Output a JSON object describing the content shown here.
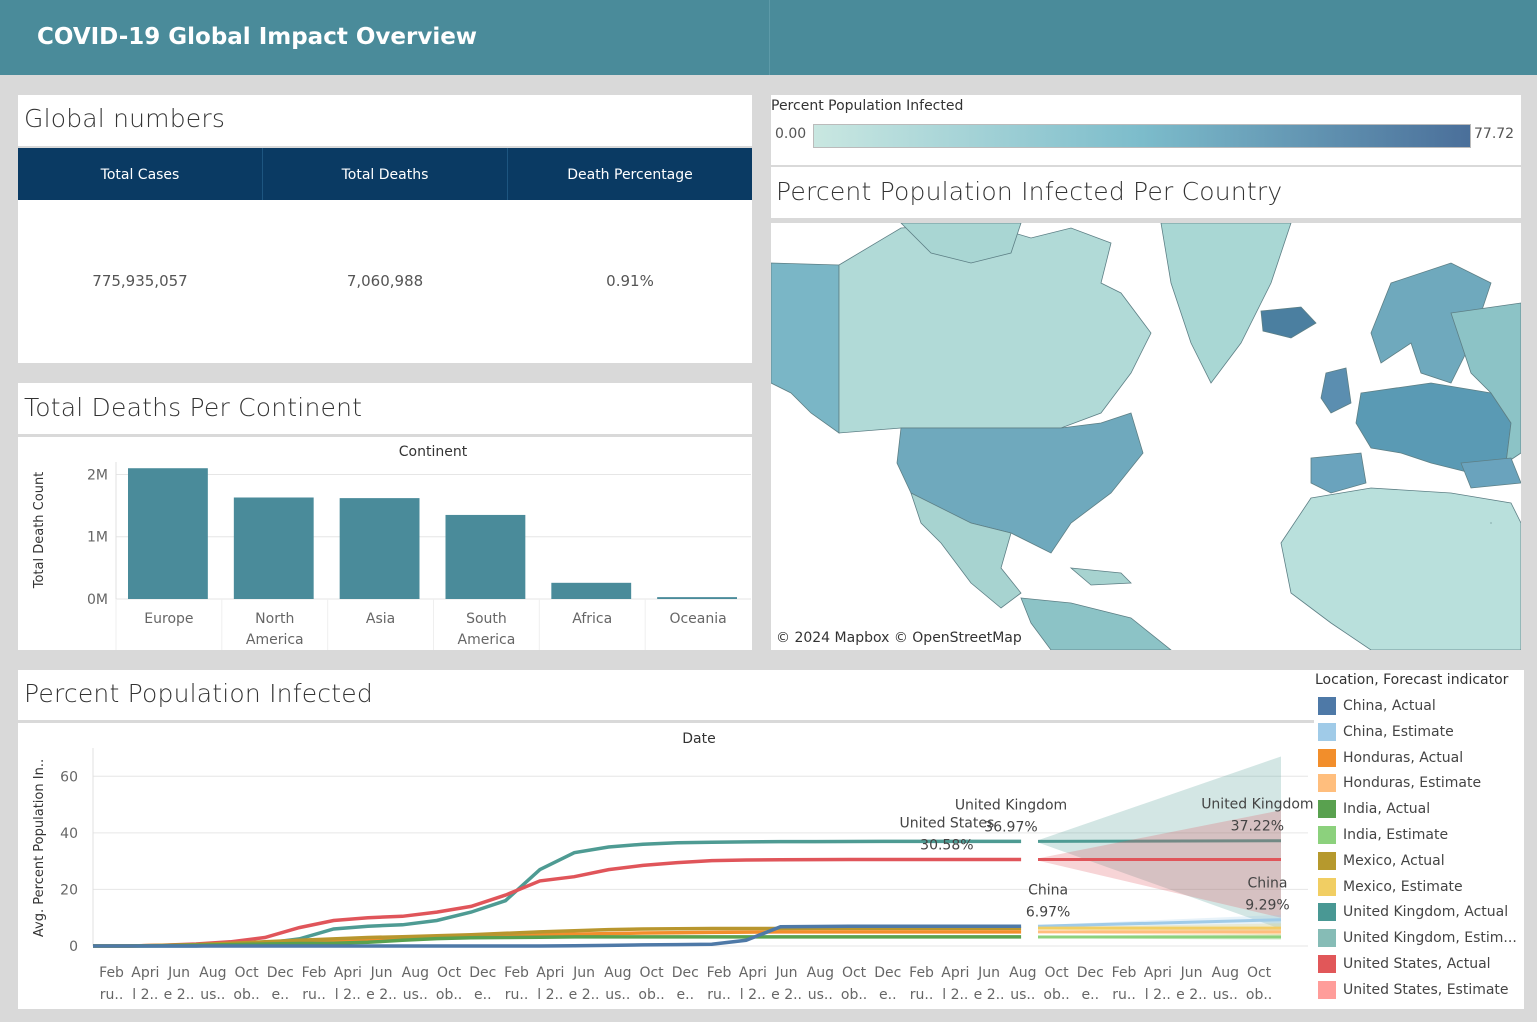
{
  "header": {
    "title": "COVID-19 Global Impact Overview"
  },
  "global_numbers": {
    "title": "Global numbers",
    "headers": [
      "Total Cases",
      "Total Deaths",
      "Death Percentage"
    ],
    "values": [
      "775,935,057",
      "7,060,988",
      "0.91%"
    ]
  },
  "map": {
    "legend_title": "Percent Population Infected",
    "legend_min": "0.00",
    "legend_max": "77.72",
    "title": "Percent Population Infected Per Country",
    "attribution": "© 2024 Mapbox  © OpenStreetMap",
    "colors": {
      "low": "#c9e7e1",
      "high": "#4a6f9a"
    }
  },
  "chart_data": [
    {
      "type": "bar",
      "title": "Total Deaths Per Continent",
      "header": "Continent",
      "ylabel": "Total Death Count",
      "categories": [
        "Europe",
        "North America",
        "Asia",
        "South America",
        "Africa",
        "Oceania"
      ],
      "category_labels": [
        [
          "Europe"
        ],
        [
          "North",
          "America"
        ],
        [
          "Asia"
        ],
        [
          "South",
          "America"
        ],
        [
          "Africa"
        ],
        [
          "Oceania"
        ]
      ],
      "values": [
        2100000,
        1630000,
        1620000,
        1350000,
        260000,
        30000
      ],
      "yticks": [
        {
          "v": 0,
          "label": "0M"
        },
        {
          "v": 1000000,
          "label": "1M"
        },
        {
          "v": 2000000,
          "label": "2M"
        }
      ],
      "ylim": [
        0,
        2200000
      ],
      "color": "#4a8b9a"
    },
    {
      "type": "line",
      "title": "Percent Population Infected",
      "header": "Date",
      "ylabel": "Avg. Percent Population In..",
      "ylim": [
        0,
        70
      ],
      "yticks": [
        0,
        20,
        40,
        60
      ],
      "xticks_top": [
        "Feb",
        "Apri",
        "Jun",
        "Aug",
        "Oct",
        "Dec",
        "Feb",
        "Apri",
        "Jun",
        "Aug",
        "Oct",
        "Dec",
        "Feb",
        "Apri",
        "Jun",
        "Aug",
        "Oct",
        "Dec",
        "Feb",
        "Apri",
        "Jun",
        "Aug",
        "Oct",
        "Dec",
        "Feb",
        "Apri",
        "Jun",
        "Aug",
        "Oct",
        "Dec",
        "Feb",
        "Apri",
        "Jun",
        "Aug",
        "Oct"
      ],
      "xticks_bottom": [
        "ru..",
        "l 2..",
        "e 2..",
        "us..",
        "ob..",
        "e..",
        "ru..",
        "l 2..",
        "e 2..",
        "us..",
        "ob..",
        "e..",
        "ru..",
        "l 2..",
        "e 2..",
        "us..",
        "ob..",
        "e..",
        "ru..",
        "l 2..",
        "e 2..",
        "us..",
        "ob..",
        "e..",
        "ru..",
        "l 2..",
        "e 2..",
        "us..",
        "ob..",
        "e..",
        "ru..",
        "l 2..",
        "e 2..",
        "us..",
        "ob.."
      ],
      "x_period_count": 36,
      "actual_end": 27.5,
      "forecast_start": 28,
      "forecast_end": 35.2,
      "series": [
        {
          "name": "United Kingdom, Actual",
          "color": "#4e9b93",
          "values": [
            0,
            0,
            0,
            0,
            0.4,
            1,
            2.5,
            6,
            7,
            7.5,
            9,
            12,
            16,
            27,
            33,
            35,
            36,
            36.5,
            36.7,
            36.8,
            36.9,
            36.9,
            36.95,
            36.97,
            36.97,
            36.97,
            36.97,
            36.97
          ]
        },
        {
          "name": "United States, Actual",
          "color": "#e0555a",
          "values": [
            0,
            0,
            0.3,
            0.7,
            1.5,
            3,
            6.5,
            9,
            10,
            10.5,
            12,
            14,
            18,
            23,
            24.5,
            27,
            28.5,
            29.5,
            30.2,
            30.4,
            30.5,
            30.55,
            30.58,
            30.58,
            30.58,
            30.58,
            30.58,
            30.58
          ]
        },
        {
          "name": "Honduras, Actual",
          "color": "#f28e2b",
          "values": [
            0,
            0,
            0.2,
            0.4,
            0.8,
            1.2,
            1.6,
            2,
            2.3,
            2.6,
            3,
            3.4,
            3.7,
            4,
            4.2,
            4.4,
            4.6,
            4.7,
            4.8,
            4.9,
            5,
            5,
            5,
            5,
            5,
            5,
            5,
            5
          ]
        },
        {
          "name": "Mexico, Actual",
          "color": "#b8962e",
          "values": [
            0,
            0,
            0.2,
            0.5,
            1,
            1.5,
            2,
            2.5,
            3,
            3.3,
            3.6,
            4,
            4.5,
            5,
            5.4,
            5.8,
            6,
            6.1,
            6.2,
            6.2,
            6.2,
            6.3,
            6.3,
            6.3,
            6.3,
            6.3,
            6.3,
            6.3
          ]
        },
        {
          "name": "India, Actual",
          "color": "#59a14f",
          "values": [
            0,
            0,
            0.1,
            0.3,
            0.5,
            0.7,
            0.9,
            1,
            1.3,
            2,
            2.6,
            2.9,
            3,
            3.1,
            3.2,
            3.2,
            3.2,
            3.2,
            3.2,
            3.2,
            3.2,
            3.2,
            3.2,
            3.2,
            3.2,
            3.2,
            3.2,
            3.2
          ]
        },
        {
          "name": "China, Actual",
          "color": "#4e79a7",
          "values": [
            0,
            0,
            0,
            0,
            0,
            0,
            0,
            0,
            0,
            0,
            0,
            0,
            0,
            0,
            0.1,
            0.2,
            0.4,
            0.5,
            0.6,
            2,
            6.8,
            6.9,
            6.95,
            6.97,
            6.97,
            6.97,
            6.97,
            6.97
          ]
        }
      ],
      "forecasts": [
        {
          "name": "United Kingdom, Estimate",
          "color": "#4e9b93",
          "start": 36.97,
          "end": 37.22,
          "low": 6,
          "high": 67
        },
        {
          "name": "United States, Estimate",
          "color": "#e0555a",
          "start": 30.58,
          "end": 30.6,
          "low": 10,
          "high": 48
        },
        {
          "name": "China, Estimate",
          "color": "#a0cbe8",
          "start": 6.97,
          "end": 9.29,
          "low": 5,
          "high": 11
        },
        {
          "name": "Mexico, Estimate",
          "color": "#f1ce63",
          "start": 6.3,
          "end": 6.3,
          "low": 4,
          "high": 8
        },
        {
          "name": "Honduras, Estimate",
          "color": "#ffbe7d",
          "start": 5,
          "end": 5,
          "low": 3.5,
          "high": 6.5
        },
        {
          "name": "India, Estimate",
          "color": "#8cd17d",
          "start": 3.2,
          "end": 3.2,
          "low": 2.2,
          "high": 4.2
        }
      ],
      "annotations": [
        {
          "text": [
            "United Kingdom",
            "36.97%"
          ],
          "at": 27.2,
          "value": 36.97
        },
        {
          "text": [
            "United Kingdom",
            "37.22%"
          ],
          "at": 34.5,
          "value": 37.22
        },
        {
          "text": [
            "United States",
            "30.58%"
          ],
          "at": 25.3,
          "value": 30.58
        },
        {
          "text": [
            "China",
            "6.97%"
          ],
          "at": 28.3,
          "value": 6.97
        },
        {
          "text": [
            "China",
            "9.29%"
          ],
          "at": 34.8,
          "value": 9.29
        }
      ],
      "legend": {
        "title": "Location, Forecast indicator",
        "items": [
          {
            "label": "China, Actual",
            "color": "#4e79a7"
          },
          {
            "label": "China, Estimate",
            "color": "#a0cbe8"
          },
          {
            "label": "Honduras, Actual",
            "color": "#f28e2b"
          },
          {
            "label": "Honduras, Estimate",
            "color": "#ffbe7d"
          },
          {
            "label": "India, Actual",
            "color": "#59a14f"
          },
          {
            "label": "India, Estimate",
            "color": "#8cd17d"
          },
          {
            "label": "Mexico, Actual",
            "color": "#b6992d"
          },
          {
            "label": "Mexico, Estimate",
            "color": "#f1ce63"
          },
          {
            "label": "United Kingdom, Actual",
            "color": "#499894"
          },
          {
            "label": "United Kingdom, Estim...",
            "color": "#86bcb6"
          },
          {
            "label": "United States, Actual",
            "color": "#e15759"
          },
          {
            "label": "United States, Estimate",
            "color": "#ff9d9a"
          }
        ]
      }
    }
  ]
}
